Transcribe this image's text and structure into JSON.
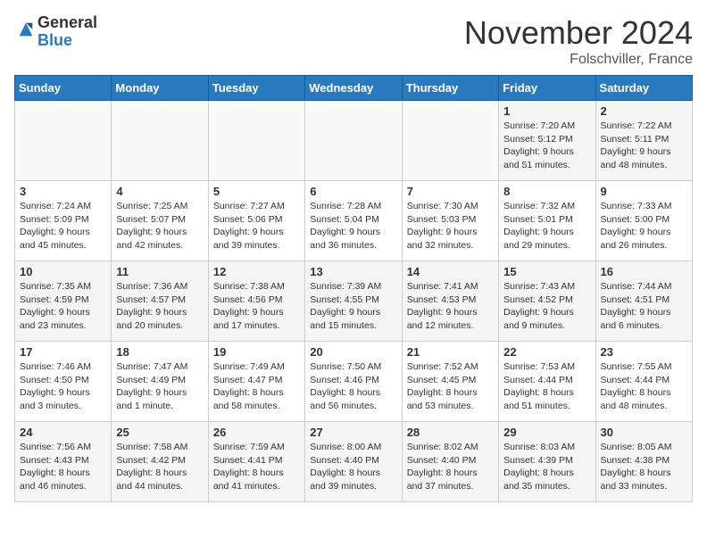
{
  "header": {
    "logo_general": "General",
    "logo_blue": "Blue",
    "month_title": "November 2024",
    "location": "Folschviller, France"
  },
  "weekdays": [
    "Sunday",
    "Monday",
    "Tuesday",
    "Wednesday",
    "Thursday",
    "Friday",
    "Saturday"
  ],
  "weeks": [
    [
      {
        "day": "",
        "info": ""
      },
      {
        "day": "",
        "info": ""
      },
      {
        "day": "",
        "info": ""
      },
      {
        "day": "",
        "info": ""
      },
      {
        "day": "",
        "info": ""
      },
      {
        "day": "1",
        "info": "Sunrise: 7:20 AM\nSunset: 5:12 PM\nDaylight: 9 hours and 51 minutes."
      },
      {
        "day": "2",
        "info": "Sunrise: 7:22 AM\nSunset: 5:11 PM\nDaylight: 9 hours and 48 minutes."
      }
    ],
    [
      {
        "day": "3",
        "info": "Sunrise: 7:24 AM\nSunset: 5:09 PM\nDaylight: 9 hours and 45 minutes."
      },
      {
        "day": "4",
        "info": "Sunrise: 7:25 AM\nSunset: 5:07 PM\nDaylight: 9 hours and 42 minutes."
      },
      {
        "day": "5",
        "info": "Sunrise: 7:27 AM\nSunset: 5:06 PM\nDaylight: 9 hours and 39 minutes."
      },
      {
        "day": "6",
        "info": "Sunrise: 7:28 AM\nSunset: 5:04 PM\nDaylight: 9 hours and 36 minutes."
      },
      {
        "day": "7",
        "info": "Sunrise: 7:30 AM\nSunset: 5:03 PM\nDaylight: 9 hours and 32 minutes."
      },
      {
        "day": "8",
        "info": "Sunrise: 7:32 AM\nSunset: 5:01 PM\nDaylight: 9 hours and 29 minutes."
      },
      {
        "day": "9",
        "info": "Sunrise: 7:33 AM\nSunset: 5:00 PM\nDaylight: 9 hours and 26 minutes."
      }
    ],
    [
      {
        "day": "10",
        "info": "Sunrise: 7:35 AM\nSunset: 4:59 PM\nDaylight: 9 hours and 23 minutes."
      },
      {
        "day": "11",
        "info": "Sunrise: 7:36 AM\nSunset: 4:57 PM\nDaylight: 9 hours and 20 minutes."
      },
      {
        "day": "12",
        "info": "Sunrise: 7:38 AM\nSunset: 4:56 PM\nDaylight: 9 hours and 17 minutes."
      },
      {
        "day": "13",
        "info": "Sunrise: 7:39 AM\nSunset: 4:55 PM\nDaylight: 9 hours and 15 minutes."
      },
      {
        "day": "14",
        "info": "Sunrise: 7:41 AM\nSunset: 4:53 PM\nDaylight: 9 hours and 12 minutes."
      },
      {
        "day": "15",
        "info": "Sunrise: 7:43 AM\nSunset: 4:52 PM\nDaylight: 9 hours and 9 minutes."
      },
      {
        "day": "16",
        "info": "Sunrise: 7:44 AM\nSunset: 4:51 PM\nDaylight: 9 hours and 6 minutes."
      }
    ],
    [
      {
        "day": "17",
        "info": "Sunrise: 7:46 AM\nSunset: 4:50 PM\nDaylight: 9 hours and 3 minutes."
      },
      {
        "day": "18",
        "info": "Sunrise: 7:47 AM\nSunset: 4:49 PM\nDaylight: 9 hours and 1 minute."
      },
      {
        "day": "19",
        "info": "Sunrise: 7:49 AM\nSunset: 4:47 PM\nDaylight: 8 hours and 58 minutes."
      },
      {
        "day": "20",
        "info": "Sunrise: 7:50 AM\nSunset: 4:46 PM\nDaylight: 8 hours and 56 minutes."
      },
      {
        "day": "21",
        "info": "Sunrise: 7:52 AM\nSunset: 4:45 PM\nDaylight: 8 hours and 53 minutes."
      },
      {
        "day": "22",
        "info": "Sunrise: 7:53 AM\nSunset: 4:44 PM\nDaylight: 8 hours and 51 minutes."
      },
      {
        "day": "23",
        "info": "Sunrise: 7:55 AM\nSunset: 4:44 PM\nDaylight: 8 hours and 48 minutes."
      }
    ],
    [
      {
        "day": "24",
        "info": "Sunrise: 7:56 AM\nSunset: 4:43 PM\nDaylight: 8 hours and 46 minutes."
      },
      {
        "day": "25",
        "info": "Sunrise: 7:58 AM\nSunset: 4:42 PM\nDaylight: 8 hours and 44 minutes."
      },
      {
        "day": "26",
        "info": "Sunrise: 7:59 AM\nSunset: 4:41 PM\nDaylight: 8 hours and 41 minutes."
      },
      {
        "day": "27",
        "info": "Sunrise: 8:00 AM\nSunset: 4:40 PM\nDaylight: 8 hours and 39 minutes."
      },
      {
        "day": "28",
        "info": "Sunrise: 8:02 AM\nSunset: 4:40 PM\nDaylight: 8 hours and 37 minutes."
      },
      {
        "day": "29",
        "info": "Sunrise: 8:03 AM\nSunset: 4:39 PM\nDaylight: 8 hours and 35 minutes."
      },
      {
        "day": "30",
        "info": "Sunrise: 8:05 AM\nSunset: 4:38 PM\nDaylight: 8 hours and 33 minutes."
      }
    ]
  ]
}
